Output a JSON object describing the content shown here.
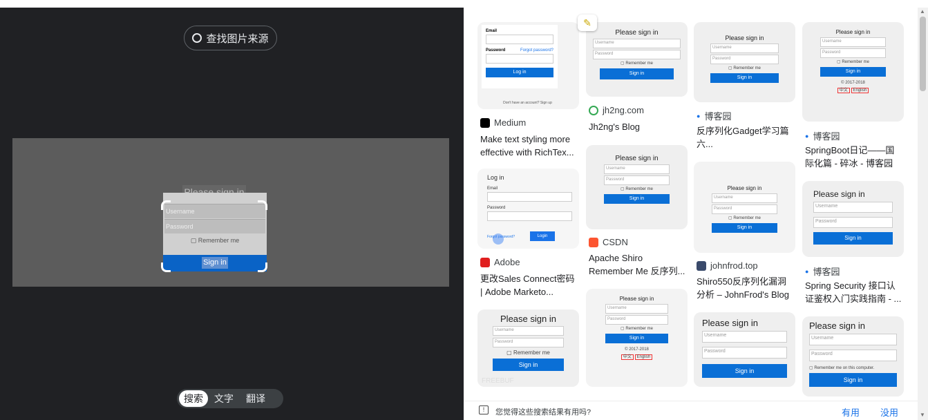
{
  "left_panel": {
    "find_source_label": "查找图片来源",
    "crop_preview": {
      "title": "Please sign in",
      "username_placeholder": "Username",
      "password_placeholder": "Password",
      "remember_label": "Remember me",
      "signin_label": "Sign in"
    },
    "tabs": [
      {
        "label": "搜索",
        "active": true
      },
      {
        "label": "文字",
        "active": false
      },
      {
        "label": "翻译",
        "active": false
      }
    ]
  },
  "results": {
    "col1": [
      {
        "site": "Medium",
        "title": "Make text styling more effective with RichTex...",
        "thumb": {
          "email": "Email",
          "password": "Password",
          "forgot": "Forgot password?",
          "button": "Log in",
          "footer": "Don't have an account? Sign up"
        }
      },
      {
        "site": "Adobe",
        "title": "更改Sales Connect密码 | Adobe Marketo...",
        "thumb": {
          "heading": "Log in",
          "email": "Email",
          "password": "Password",
          "forgot": "Forgot password?",
          "button": "Login"
        }
      },
      {
        "thumb": {
          "heading": "Please sign in",
          "username": "Username",
          "password": "Password",
          "remember": "Remember me",
          "button": "Sign in",
          "watermark": "FREEBUF"
        }
      }
    ],
    "col2": [
      {
        "site": "jh2ng.com",
        "title": "Jh2ng's Blog",
        "thumb": {
          "heading": "Please sign in",
          "username": "Username",
          "password": "Password",
          "remember": "Remember me",
          "button": "Sign in"
        }
      },
      {
        "site": "CSDN",
        "title": "Apache Shiro Remember Me 反序列...",
        "thumb": {
          "heading": "Please sign in",
          "username": "Username",
          "password": "Password",
          "remember": "Remember me",
          "button": "Sign in"
        }
      },
      {
        "thumb": {
          "heading": "Please sign in",
          "username": "Username",
          "password": "Password",
          "remember": "Remember me",
          "button": "Sign in",
          "copyright": "© 2017-2018",
          "lang1": "中文",
          "lang2": "English"
        }
      }
    ],
    "col3": [
      {
        "site": "博客园",
        "title": "反序列化Gadget学习篇 六...",
        "thumb": {
          "heading": "Please sign in",
          "username": "Username",
          "password": "Password",
          "remember": "Remember me",
          "button": "Sign in"
        }
      },
      {
        "site": "johnfrod.top",
        "title": "Shiro550反序列化漏洞 分析 – JohnFrod's Blog",
        "thumb": {
          "heading": "Please sign in",
          "username": "Username",
          "password": "Password",
          "remember": "Remember me",
          "button": "Sign in"
        }
      },
      {
        "thumb": {
          "heading": "Please sign in",
          "username": "Username",
          "password": "Password",
          "button": "Sign in"
        }
      }
    ],
    "col4": [
      {
        "site": "博客园",
        "title": "SpringBoot日记——国 际化篇 - 碎冰 - 博客园",
        "thumb": {
          "heading": "Please sign in",
          "username": "Username",
          "password": "Password",
          "remember": "Remember me",
          "button": "Sign in",
          "copyright": "© 2017-2018",
          "lang1": "中文",
          "lang2": "English"
        }
      },
      {
        "site": "博客园",
        "title": "Spring Security 接口认 证鉴权入门实践指南 - ...",
        "thumb": {
          "heading": "Please sign in",
          "username": "Username",
          "password": "Password",
          "button": "Sign in"
        }
      },
      {
        "thumb": {
          "heading": "Please sign in",
          "username": "Username",
          "password": "Password",
          "remember": "Remember me on this computer.",
          "button": "Sign in"
        }
      }
    ]
  },
  "footer": {
    "feedback_question": "您觉得这些搜索结果有用吗?",
    "useful_label": "有用",
    "not_useful_label": "没用"
  },
  "colors": {
    "dark_bg": "#202124",
    "accent_blue": "#1a73e8",
    "signin_blue": "#0a6fd6"
  }
}
